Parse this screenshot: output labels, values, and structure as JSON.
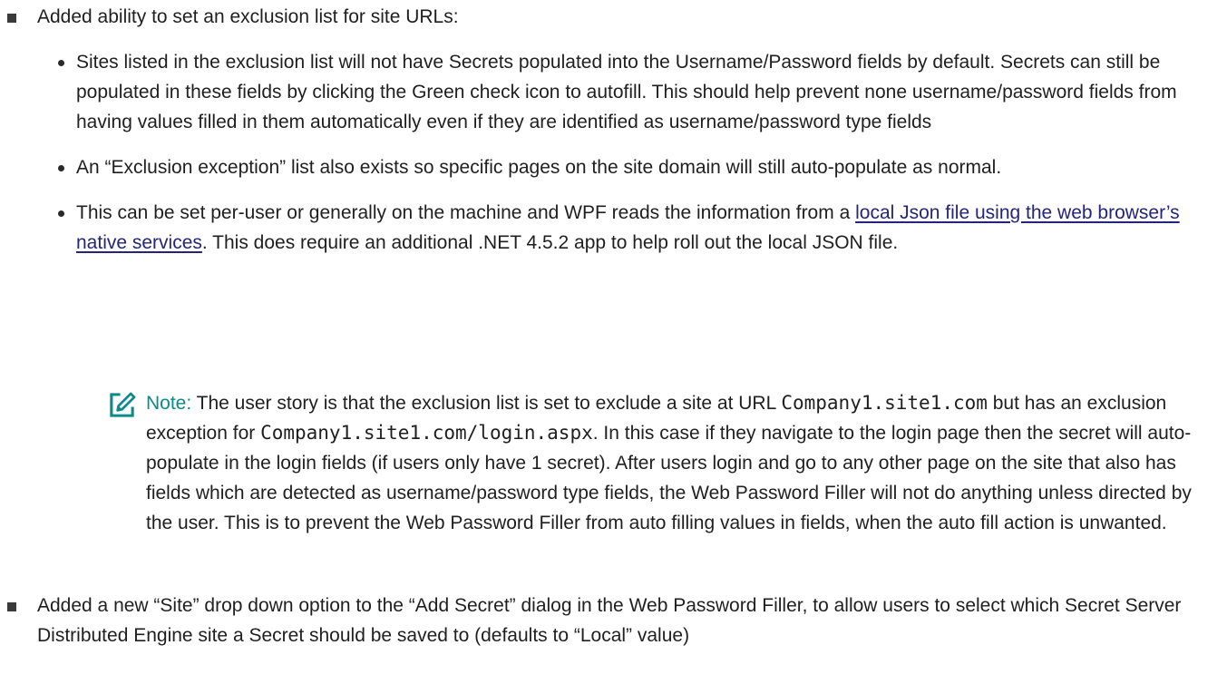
{
  "item1": {
    "text": "Added ability to set an exclusion list for site URLs:",
    "subitems": [
      {
        "text": "Sites listed in the exclusion list will not have Secrets populated into the Username/Password fields by default. Secrets can still be populated in these fields by clicking the Green check icon to autofill. This should help prevent none username/password fields from having values filled in them automatically even if they are identified as username/password type fields"
      },
      {
        "text": "An “Exclusion exception” list also exists so specific pages on the site domain will still auto-populate as normal."
      },
      {
        "text_before": "This can be set per-user or generally on the machine and WPF reads the information from a ",
        "link": "local Json file using the web browser’s native services",
        "text_after": ". This does require an additional .NET 4.5.2 app to help roll out the local JSON file."
      }
    ]
  },
  "note": {
    "label": "Note:",
    "t1": " The user story is that the exclusion list is set to exclude a site at URL ",
    "code1": "Company1.site1.com",
    "t2": " but has an exclusion exception for ",
    "code2": "Company1.site1.com/login.aspx",
    "t3": ". In this case if they navigate to the login page then the secret will auto-populate in the login fields (if users only have 1 secret). After users login and go to any other page on the site that also has fields which are detected as username/password type fields, the Web Password Filler will not do anything unless directed by the user. This is to prevent the Web Password Filler from auto filling values in fields, when the auto fill action is unwanted."
  },
  "item2": {
    "text": "Added a new “Site” drop down option to the “Add Secret” dialog in the Web Password Filler, to allow users to select which Secret Server Distributed Engine site a Secret should be saved to (defaults to “Local” value)"
  },
  "colors": {
    "text": "#1f1f1f",
    "link": "#24247a",
    "note_label": "#0a8a8a"
  },
  "icons": {
    "note": "note-pencil-icon"
  }
}
